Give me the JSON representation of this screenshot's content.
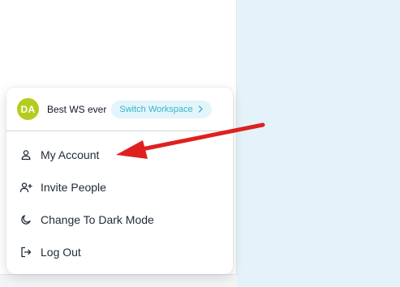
{
  "workspace": {
    "avatar_initials": "DA",
    "avatar_color": "#b5cc1c",
    "name": "Best WS ever",
    "switch_label": "Switch Workspace",
    "switch_icon": "chevron-right-icon"
  },
  "menu": {
    "items": [
      {
        "label": "My Account",
        "icon": "user-icon"
      },
      {
        "label": "Invite People",
        "icon": "user-plus-icon"
      },
      {
        "label": "Change To Dark Mode",
        "icon": "moon-icon"
      },
      {
        "label": "Log Out",
        "icon": "logout-icon"
      }
    ]
  },
  "annotation": {
    "color": "#e02020",
    "points_to": "My Account"
  },
  "colors": {
    "right_pane": "#e4f3fa",
    "switch_bg": "#e3f5fa",
    "switch_text": "#37b4d0"
  }
}
